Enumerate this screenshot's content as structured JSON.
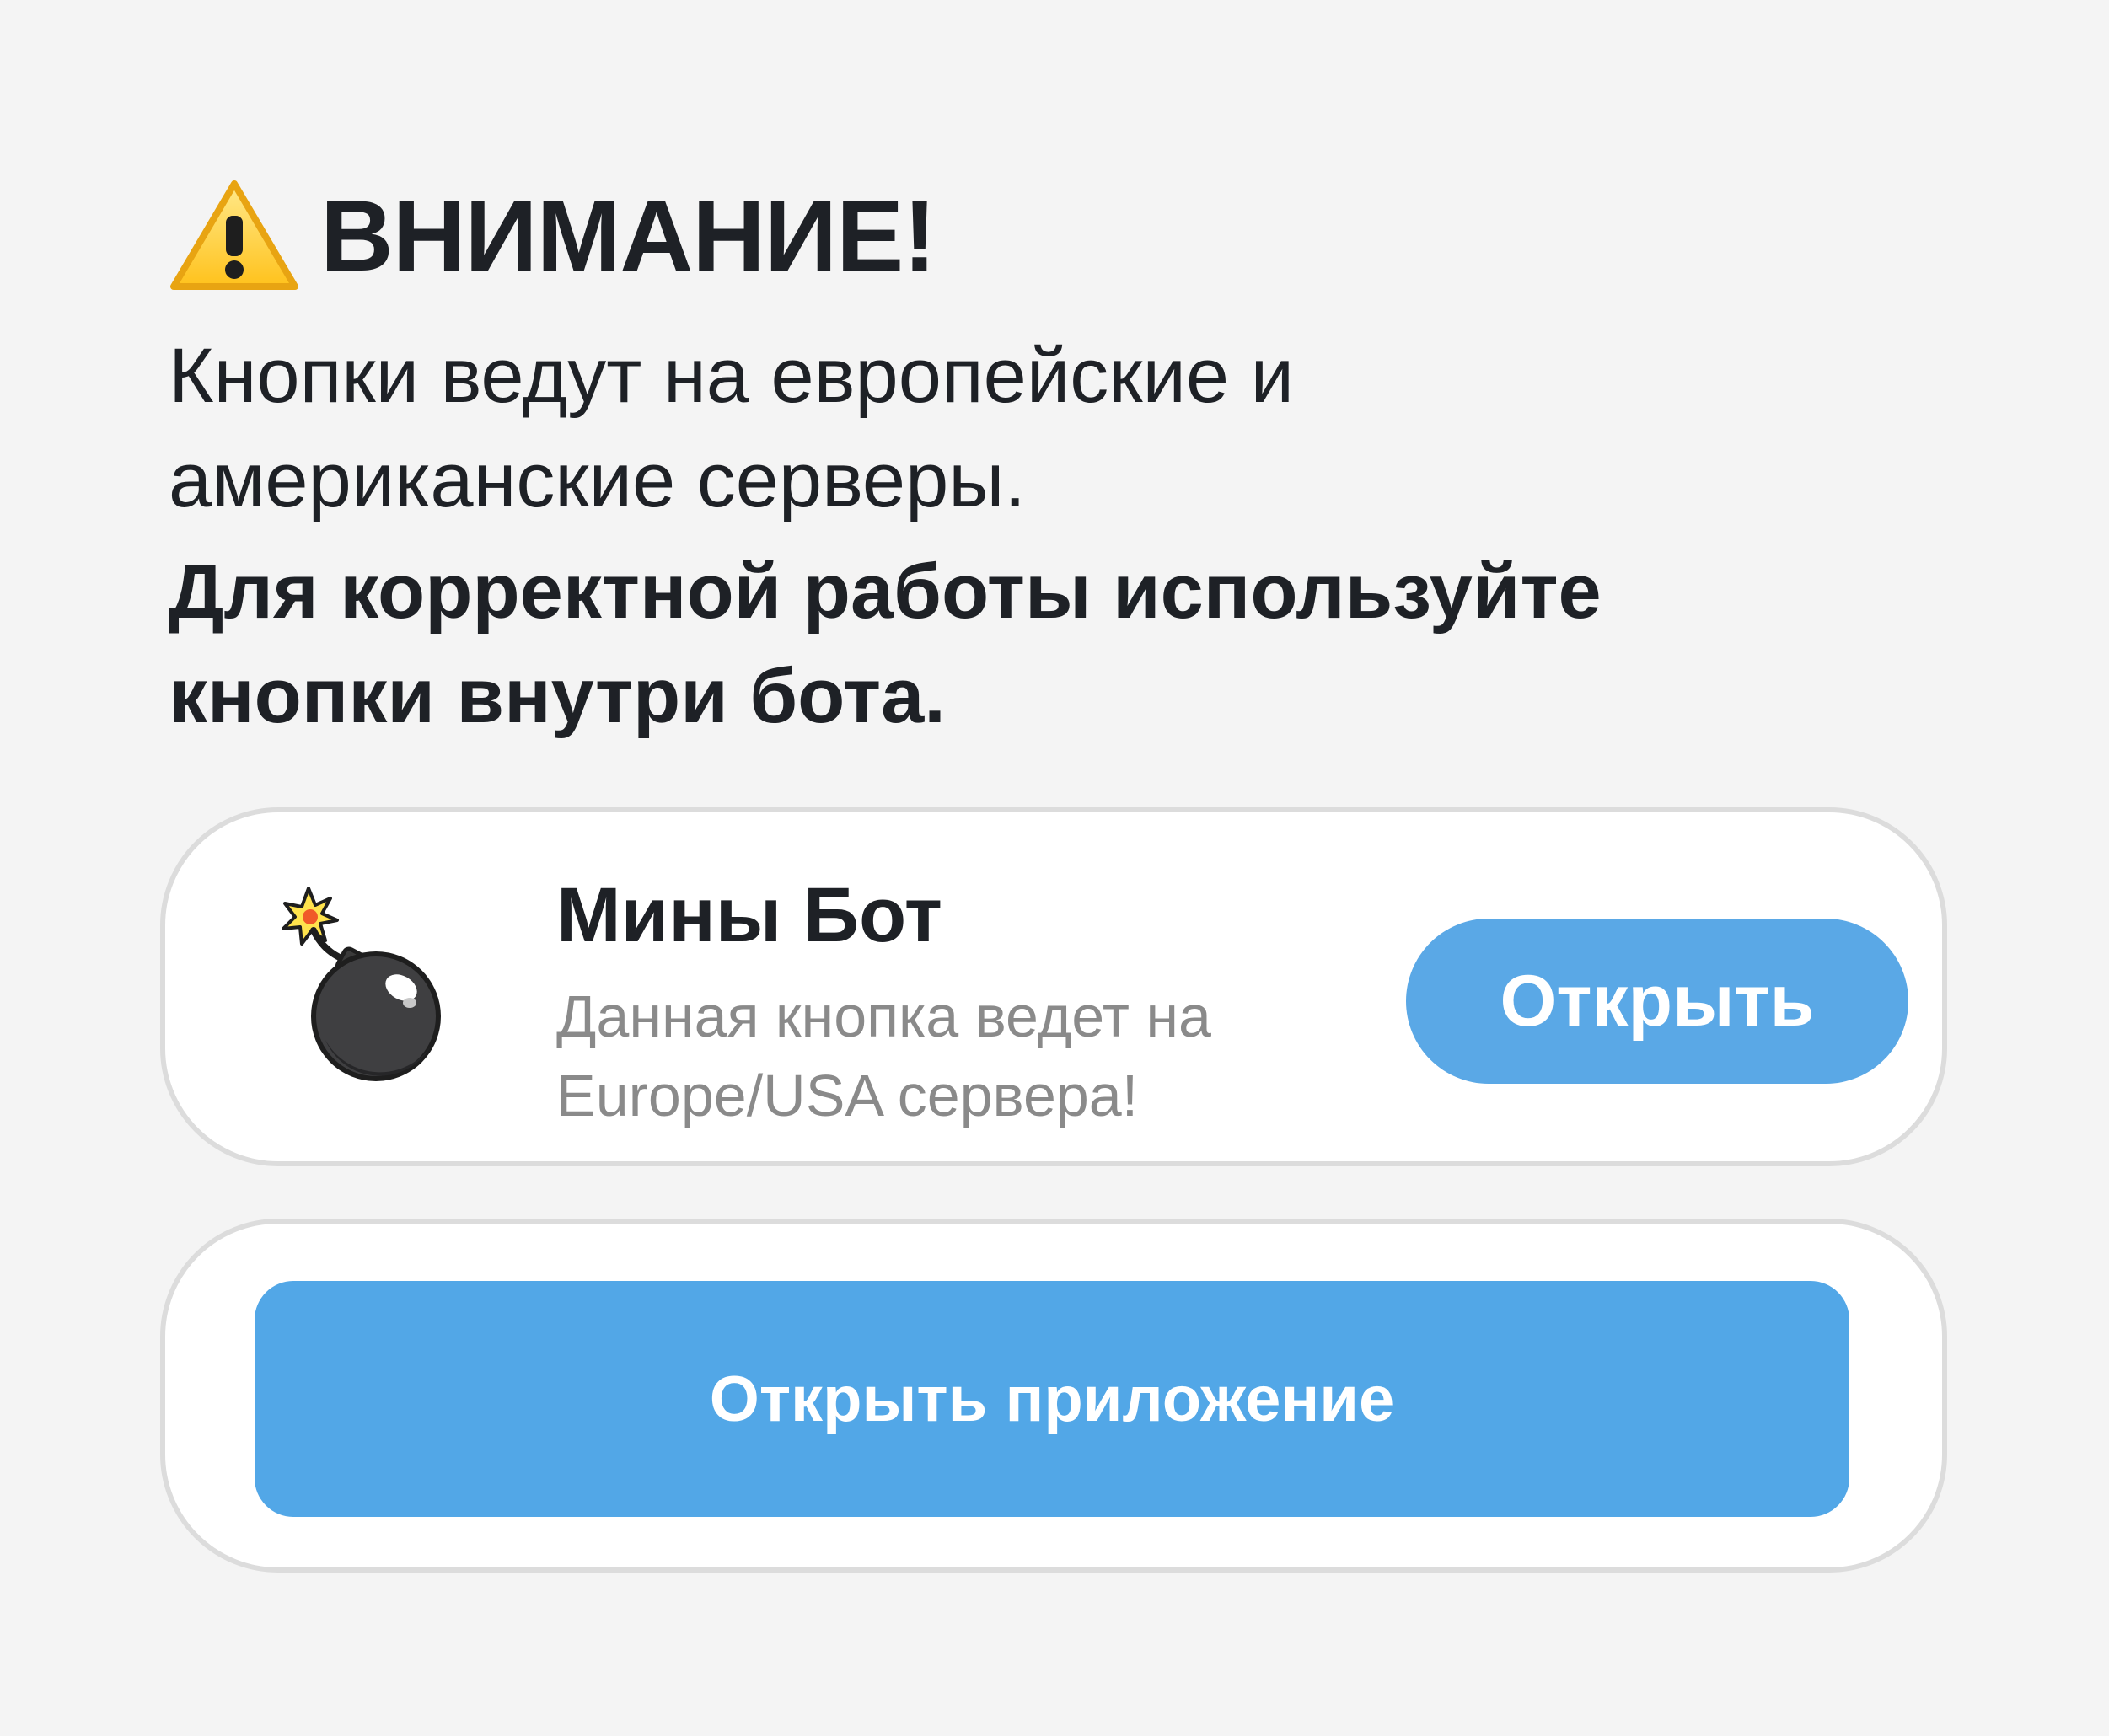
{
  "warning": {
    "title": "ВНИМАНИЕ!",
    "icon": "warning-icon",
    "line1": "Кнопки ведут на европейские и",
    "line2": "американские серверы.",
    "bold_line1": "Для корректной работы используйте",
    "bold_line2": "кнопки внутри бота."
  },
  "bot_card": {
    "icon": "bomb-icon",
    "name": "Мины Бот",
    "description_line1": "Данная кнопка ведет на",
    "description_line2": "Europe/USA сервера!",
    "open_label": "Открыть"
  },
  "app_card": {
    "open_app_label": "Открыть приложение"
  },
  "colors": {
    "background": "#f4f4f4",
    "accent": "#52a7e7",
    "card_border": "#dcdcdc",
    "muted_text": "#8a8a8a"
  }
}
